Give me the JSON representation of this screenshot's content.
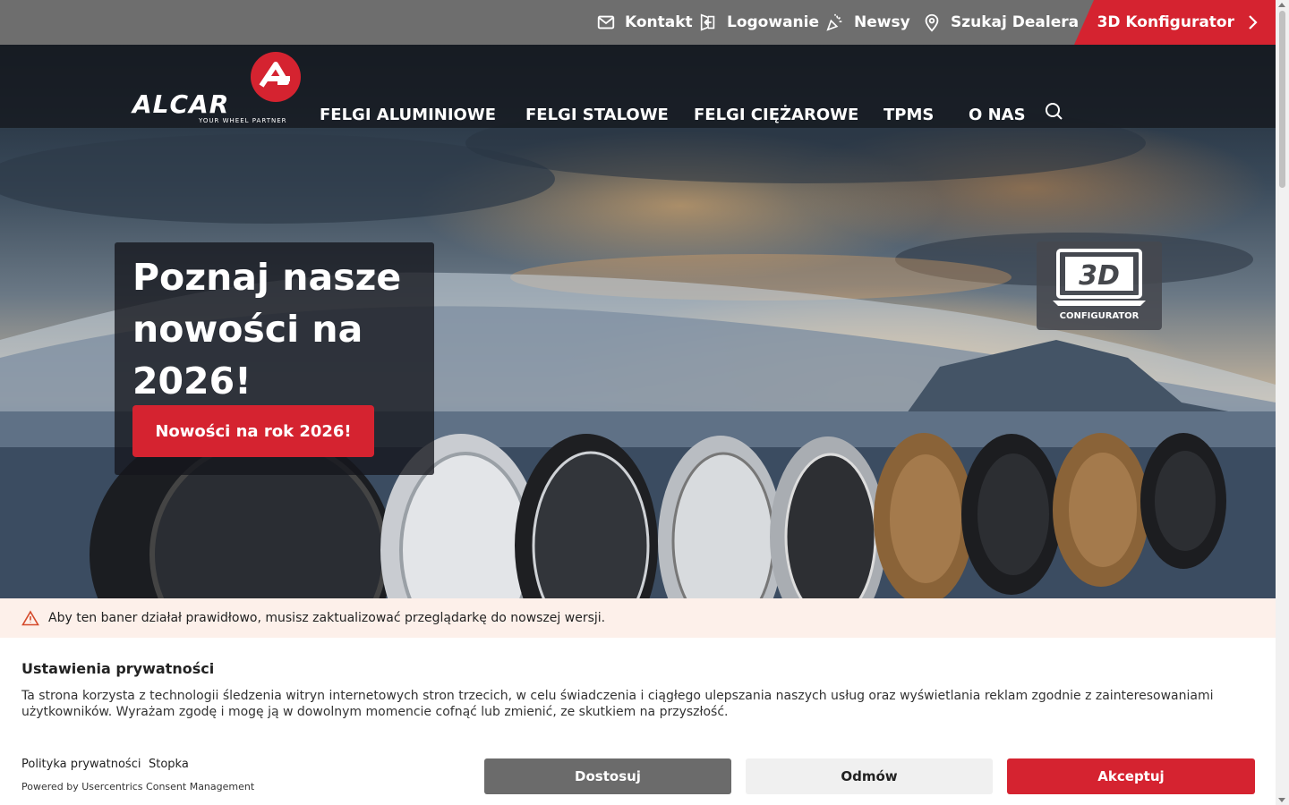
{
  "topbar": {
    "kontakt": "Kontakt",
    "logowanie": "Logowanie",
    "newsy": "Newsy",
    "dealer": "Szukaj Dealera",
    "konfigurator": "3D Konfigurator"
  },
  "logo": {
    "word": "ALCAR",
    "tagline": "YOUR WHEEL PARTNER"
  },
  "nav": {
    "items": [
      "FELGI ALUMINIOWE",
      "FELGI STALOWE",
      "FELGI CIĘŻAROWE",
      "TPMS",
      "O NAS"
    ]
  },
  "hero": {
    "title": "Poznaj nasze nowości na 2026!",
    "button": "Nowości na rok 2026!",
    "configurator_3d": "3D",
    "configurator_label": "CONFIGURATOR"
  },
  "consent": {
    "warning": "Aby ten baner działał prawidłowo, musisz zaktualizować przeglądarkę do nowszej wersji.",
    "title": "Ustawienia prywatności",
    "description": "Ta strona korzysta z technologii śledzenia witryn internetowych stron trzecich, w celu świadczenia i ciągłego ulepszania naszych usług oraz wyświetlania reklam zgodnie z zainteresowaniami użytkowników. Wyrażam zgodę i mogę ją w dowolnym momencie cofnąć lub zmienić, ze skutkiem na przyszłość.",
    "privacy_link": "Polityka prywatności",
    "footer_link": "Stopka",
    "powered": "Powered by Usercentrics Consent Management",
    "btn_customize": "Dostosuj",
    "btn_reject": "Odmów",
    "btn_accept": "Akceptuj"
  },
  "colors": {
    "brand_red": "#d52330",
    "topbar_gray": "#6e6e6e",
    "navbar_dark": "#161a20"
  },
  "icons": [
    "mail-icon",
    "login-icon",
    "news-icon",
    "location-icon",
    "chevron-right-icon",
    "search-icon",
    "warning-icon",
    "laptop-3d-icon"
  ]
}
